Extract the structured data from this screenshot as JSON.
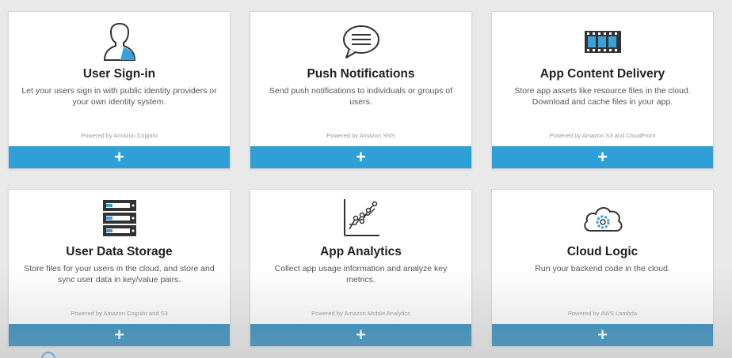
{
  "cards": [
    {
      "icon": "user-silhouette-icon",
      "title": "User Sign-in",
      "description": "Let your users sign in with public identity providers or your own identity system.",
      "powered_by": "Powered by Amazon Cognito",
      "add_label": "+"
    },
    {
      "icon": "chat-bubble-icon",
      "title": "Push Notifications",
      "description": "Send push notifications to individuals or groups of users.",
      "powered_by": "Powered by Amazon SNS",
      "add_label": "+"
    },
    {
      "icon": "film-strip-icon",
      "title": "App Content Delivery",
      "description": "Store app assets like resource files in the cloud. Download and cache files in your app.",
      "powered_by": "Powered by Amazon S3 and CloudFront",
      "add_label": "+"
    },
    {
      "icon": "server-rack-icon",
      "title": "User Data Storage",
      "description": "Store files for your users in the cloud, and store and sync user data in key/value pairs.",
      "powered_by": "Powered by Amazon Cognito and S3",
      "add_label": "+"
    },
    {
      "icon": "line-graph-icon",
      "title": "App Analytics",
      "description": "Collect app usage information and analyze key metrics.",
      "powered_by": "Powered by Amazon Mobile Analytics",
      "add_label": "+"
    },
    {
      "icon": "cloud-gear-icon",
      "title": "Cloud Logic",
      "description": "Run your backend code in the cloud.",
      "powered_by": "Powered by AWS Lambda",
      "add_label": "+"
    }
  ],
  "colors": {
    "add_bar": "#2f9fd8",
    "add_bar_row2": "#2b8bbd",
    "icon_accent": "#3aa0d8"
  }
}
